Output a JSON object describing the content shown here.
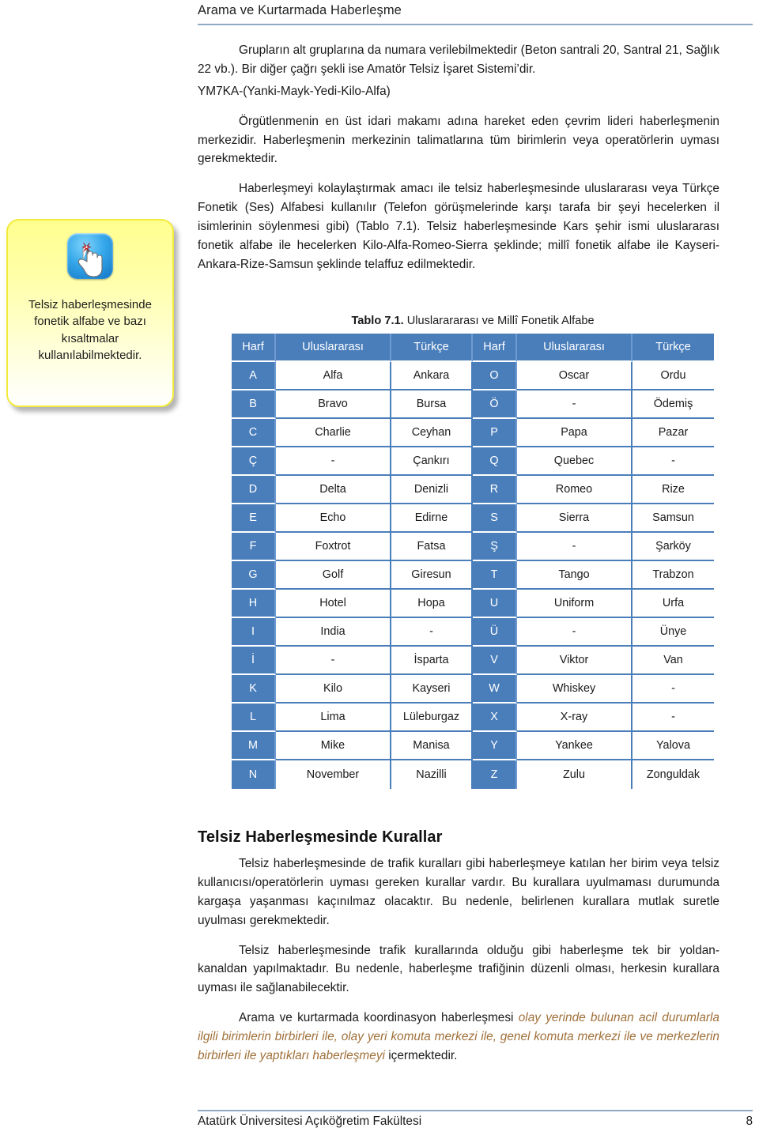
{
  "header": {
    "title": "Arama ve Kurtarmada Haberleşme"
  },
  "callout": {
    "icon": "hand-reminder-icon",
    "text": "Telsiz haberleşmesinde fonetik alfabe ve bazı kısaltmalar kullanılabilmektedir.",
    "border_color": "#f2ea3c",
    "fill_color": "#ffff8f"
  },
  "content": {
    "p1": "Grupların alt gruplarına da numara verilebilmektedir (Beton santrali 20, Santral 21, Sağlık 22 vb.). Bir diğer çağrı şekli ise Amatör Telsiz İşaret Sistemi’dir.",
    "callsign_line": "YM7KA-(Yanki-Mayk-Yedi-Kilo-Alfa)",
    "p2": "Örgütlenmenin en üst idari makamı adına hareket eden çevrim lideri haberleşmenin merkezidir. Haberleşmenin merkezinin talimatlarına tüm birimlerin veya operatörlerin uyması gerekmektedir.",
    "p3": "Haberleşmeyi kolaylaştırmak amacı ile telsiz haberleşmesinde uluslararası veya Türkçe Fonetik (Ses) Alfabesi kullanılır (Telefon görüşmelerinde karşı tarafa bir şeyi hecelerken il isimlerinin söylenmesi gibi) (Tablo 7.1). Telsiz haberleşmesinde Kars şehir ismi uluslararası fonetik alfabe ile hecelerken Kilo-Alfa-Romeo-Sierra şeklinde; millî fonetik alfabe ile Kayseri-Ankara-Rize-Samsun şeklinde telaffuz edilmektedir."
  },
  "table": {
    "caption_bold": "Tablo 7.1.",
    "caption_rest": " Uluslarararası ve Millî Fonetik Alfabe",
    "header_color": "#4a7ebb",
    "columns": [
      "Harf",
      "Uluslararası",
      "Türkçe",
      "Harf",
      "Uluslararası",
      "Türkçe"
    ],
    "rows": [
      [
        "A",
        "Alfa",
        "Ankara",
        "O",
        "Oscar",
        "Ordu"
      ],
      [
        "B",
        "Bravo",
        "Bursa",
        "Ö",
        "-",
        "Ödemiş"
      ],
      [
        "C",
        "Charlie",
        "Ceyhan",
        "P",
        "Papa",
        "Pazar"
      ],
      [
        "Ç",
        "-",
        "Çankırı",
        "Q",
        "Quebec",
        "-"
      ],
      [
        "D",
        "Delta",
        "Denizli",
        "R",
        "Romeo",
        "Rize"
      ],
      [
        "E",
        "Echo",
        "Edirne",
        "S",
        "Sierra",
        "Samsun"
      ],
      [
        "F",
        "Foxtrot",
        "Fatsa",
        "Ş",
        "-",
        "Şarköy"
      ],
      [
        "G",
        "Golf",
        "Giresun",
        "T",
        "Tango",
        "Trabzon"
      ],
      [
        "H",
        "Hotel",
        "Hopa",
        "U",
        "Uniform",
        "Urfa"
      ],
      [
        "I",
        "India",
        "-",
        "Ü",
        "-",
        "Ünye"
      ],
      [
        "İ",
        "-",
        "İsparta",
        "V",
        "Viktor",
        "Van"
      ],
      [
        "K",
        "Kilo",
        "Kayseri",
        "W",
        "Whiskey",
        "-"
      ],
      [
        "L",
        "Lima",
        "Lüleburgaz",
        "X",
        "X-ray",
        "-"
      ],
      [
        "M",
        "Mike",
        "Manisa",
        "Y",
        "Yankee",
        "Yalova"
      ],
      [
        "N",
        "November",
        "Nazilli",
        "Z",
        "Zulu",
        "Zonguldak"
      ]
    ]
  },
  "lower": {
    "title": "Telsiz Haberleşmesinde Kurallar",
    "p1": "Telsiz haberleşmesinde de trafik kuralları gibi haberleşmeye katılan her birim veya telsiz kullanıcısı/operatörlerin uyması gereken kurallar vardır. Bu kurallara uyulmaması durumunda kargaşa yaşanması kaçınılmaz olacaktır. Bu nedenle, belirlenen kurallara mutlak suretle uyulması gerekmektedir.",
    "p2": "Telsiz haberleşmesinde trafik kurallarında olduğu gibi haberleşme tek bir yoldan-kanaldan yapılmaktadır. Bu nedenle, haberleşme trafiğinin düzenli olması, herkesin kurallara uyması ile sağlanabilecektir.",
    "p3_lead": "Arama ve kurtarmada koordinasyon haberleşmesi ",
    "p3_italic": "olay yerinde bulunan acil durumlarla ilgili birimlerin birbirleri ile, olay yeri komuta merkezi ile, genel komuta merkezi ile ve merkezlerin birbirleri ile yaptıkları haberleşmeyi",
    "p3_tail": " içermektedir.",
    "italic_color": "#a0703a"
  },
  "footer": {
    "institution": "Atatürk Üniversitesi Açıköğretim Fakültesi",
    "page_number": "8"
  }
}
